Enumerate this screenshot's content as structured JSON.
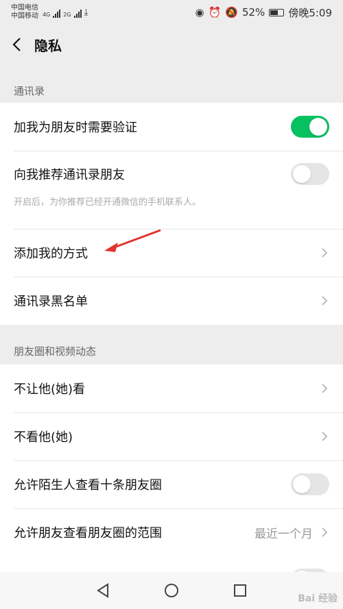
{
  "status": {
    "carrier1": "中国电信",
    "carrier2": "中国移动",
    "net1": "4G",
    "net2": "2G",
    "battery": "52%",
    "time": "傍晚5:09"
  },
  "header": {
    "title": "隐私"
  },
  "sections": {
    "contacts": {
      "title": "通讯录",
      "verify_label": "加我为朋友时需要验证",
      "verify_on": true,
      "recommend_label": "向我推荐通讯录朋友",
      "recommend_desc": "开启后，为你推荐已经开通微信的手机联系人。",
      "recommend_on": false,
      "add_methods_label": "添加我的方式",
      "blacklist_label": "通讯录黑名单"
    },
    "moments": {
      "title": "朋友圈和视频动态",
      "hide_from_label": "不让他(她)看",
      "hide_label": "不看他(她)",
      "stranger_ten_label": "允许陌生人查看十条朋友圈",
      "stranger_ten_on": false,
      "range_label": "允许朋友查看朋友圈的范围",
      "range_value": "最近一个月"
    }
  },
  "watermark": "Bai 经验",
  "colors": {
    "toggle_on": "#07c160",
    "accent_arrow": "#e5322d"
  },
  "icons": [
    "back-arrow-icon",
    "chevron-right-icon",
    "nav-back-icon",
    "nav-home-icon",
    "nav-recents-icon"
  ]
}
